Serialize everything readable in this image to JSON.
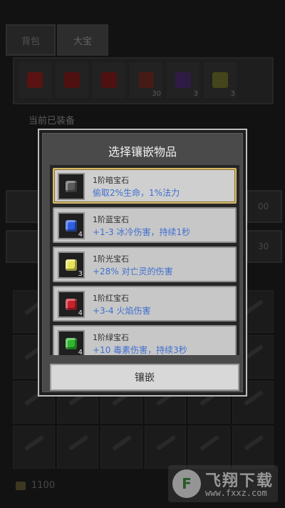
{
  "background": {
    "tabs": [
      {
        "label": "背包"
      },
      {
        "label": "大宝"
      }
    ],
    "item_strip": [
      {
        "color": "#8a1c1c",
        "count": ""
      },
      {
        "color": "#7a1a1a",
        "count": ""
      },
      {
        "color": "#7a1a1a",
        "count": ""
      },
      {
        "color": "#6a2a22",
        "count": "30"
      },
      {
        "color": "#4a2a6a",
        "count": "3"
      },
      {
        "color": "#6a6a2a",
        "count": "3"
      }
    ],
    "equipped_label": "当前已装备",
    "side_numbers": [
      "00",
      "30"
    ],
    "gold": "1100"
  },
  "watermark": {
    "title": "飞翔下载",
    "url": "www.fxxz.com",
    "logo_glyph": "F"
  },
  "modal": {
    "title": "选择镶嵌物品",
    "button_label": "镶嵌",
    "gems": [
      {
        "name": "1阶暗宝石",
        "desc": "偷取2%生命，1%法力",
        "count": "",
        "color": "#5a5a5a",
        "selected": true
      },
      {
        "name": "1阶蓝宝石",
        "desc": "+1-3 冰冷伤害，持续1秒",
        "count": "4",
        "color": "#2f5fe0",
        "selected": false
      },
      {
        "name": "1阶光宝石",
        "desc": "+28% 对亡灵的伤害",
        "count": "3",
        "color": "#e6e35a",
        "selected": false
      },
      {
        "name": "1阶红宝石",
        "desc": "+3-4 火焰伤害",
        "count": "4",
        "color": "#c8222c",
        "selected": false
      },
      {
        "name": "1阶绿宝石",
        "desc": "+10 毒素伤害，持续3秒",
        "count": "4",
        "color": "#2fb52f",
        "selected": false
      }
    ]
  }
}
